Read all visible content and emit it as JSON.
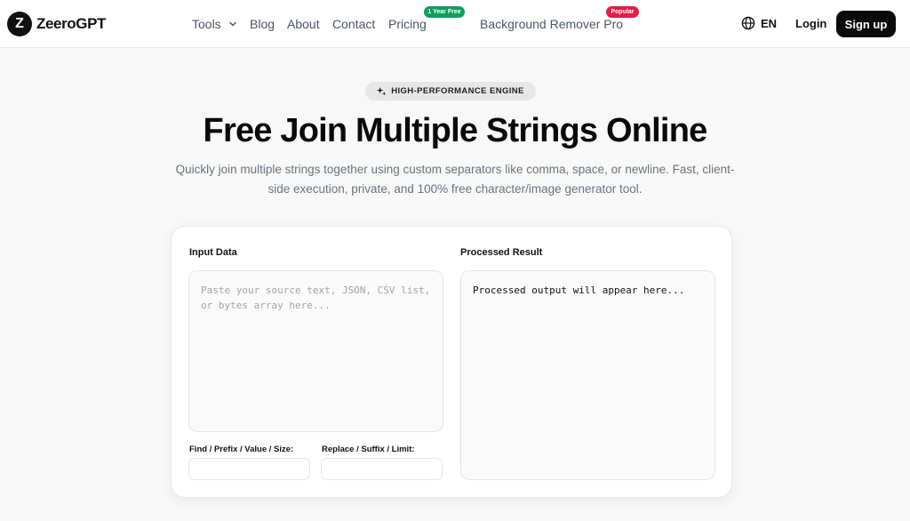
{
  "nav": {
    "logo_letter": "Z",
    "logo_text": "ZeeroGPT",
    "links": {
      "tools": "Tools",
      "blog": "Blog",
      "about": "About",
      "contact": "Contact",
      "pricing": "Pricing",
      "bg_remover": "Background Remover Pro"
    },
    "badges": {
      "pricing": "1 Year Free",
      "bg_remover": "Popular"
    },
    "language": "EN",
    "login": "Login",
    "signup": "Sign up",
    "icons": {
      "tools_dropdown": "chevron-down-icon",
      "language": "globe-icon"
    }
  },
  "hero": {
    "pill_icon": "sparkle-icon",
    "pill": "HIGH-PERFORMANCE ENGINE",
    "title": "Free Join Multiple Strings Online",
    "subtitle": "Quickly join multiple strings together using custom separators like comma, space, or newline. Fast, client-side execution, private, and 100% free character/image generator tool."
  },
  "tool": {
    "input_label": "Input Data",
    "input_placeholder": "Paste your source text, JSON, CSV list, or bytes array here...",
    "result_label": "Processed Result",
    "result_placeholder": "Processed output will appear here...",
    "find_label": "Find / Prefix / Value / Size:",
    "find_value": "",
    "replace_label": "Replace / Suffix / Limit:",
    "replace_value": ""
  },
  "colors": {
    "signup_bg": "#0b0b0b",
    "badge_free": "#0f9f5c",
    "badge_popular": "#e11d48",
    "page_bg": "#f8f8f8"
  }
}
